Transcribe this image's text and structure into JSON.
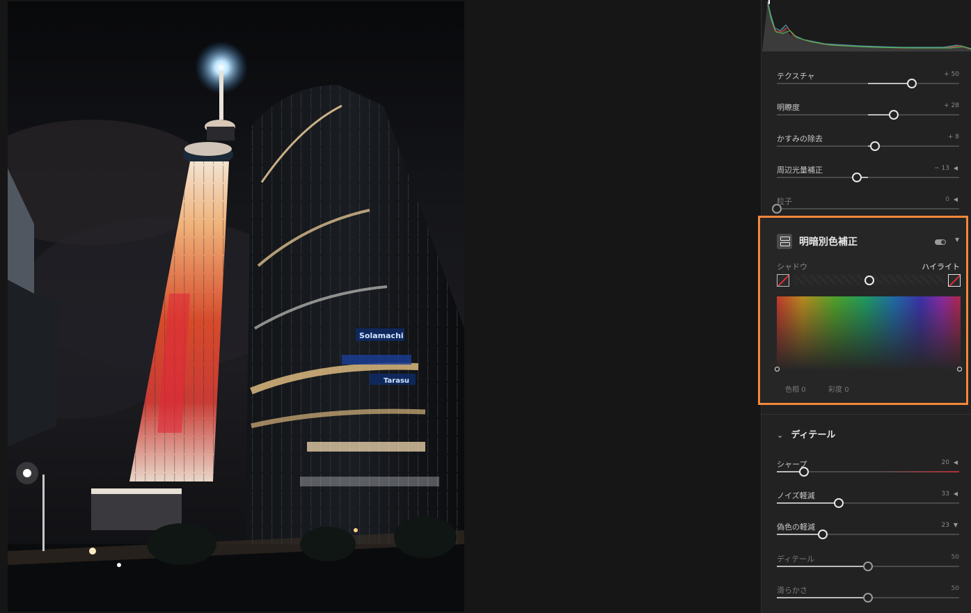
{
  "panel": {
    "effects_sliders": [
      {
        "label": "テクスチャ",
        "value": "+ 50",
        "fraction": 0.74,
        "center": 0.5,
        "dim": false,
        "arrow": false
      },
      {
        "label": "明瞭度",
        "value": "+ 28",
        "fraction": 0.64,
        "center": 0.5,
        "dim": false,
        "arrow": false
      },
      {
        "label": "かすみの除去",
        "value": "+ 8",
        "fraction": 0.54,
        "center": 0.5,
        "dim": false,
        "arrow": false
      },
      {
        "label": "周辺光量補正",
        "value": "− 13",
        "fraction": 0.44,
        "center": 0.5,
        "dim": false,
        "arrow": true
      },
      {
        "label": "粒子",
        "value": "0",
        "fraction": 0.0,
        "center": 0.0,
        "dim": true,
        "arrow": true
      }
    ],
    "split_toning": {
      "title": "明暗別色補正",
      "shadow_label": "シャドウ",
      "highlight_label": "ハイライト",
      "balance": 0.5,
      "hue_label": "色相",
      "hue_value": "0",
      "sat_label": "彩度",
      "sat_value": "0",
      "highlight_color": "#f5883b"
    },
    "detail": {
      "title": "ディテール",
      "sliders": [
        {
          "label": "シャープ",
          "value": "20",
          "fraction": 0.15,
          "center": 0.0,
          "dim": false,
          "arrow": true,
          "accent": "#b3323a"
        },
        {
          "label": "ノイズ軽減",
          "value": "33",
          "fraction": 0.34,
          "center": 0.0,
          "dim": false,
          "arrow": true
        },
        {
          "label": "偽色の軽減",
          "value": "23",
          "fraction": 0.25,
          "center": 0.0,
          "dim": false,
          "arrow": "down"
        },
        {
          "label": "ディテール",
          "value": "50",
          "fraction": 0.5,
          "center": 0.0,
          "dim": true,
          "arrow": false
        },
        {
          "label": "滑らかさ",
          "value": "50",
          "fraction": 0.5,
          "center": 0.0,
          "dim": true,
          "arrow": false
        }
      ]
    }
  },
  "photo": {
    "sign_text_1": "Solamachi",
    "sign_text_2": "Tarasu"
  }
}
